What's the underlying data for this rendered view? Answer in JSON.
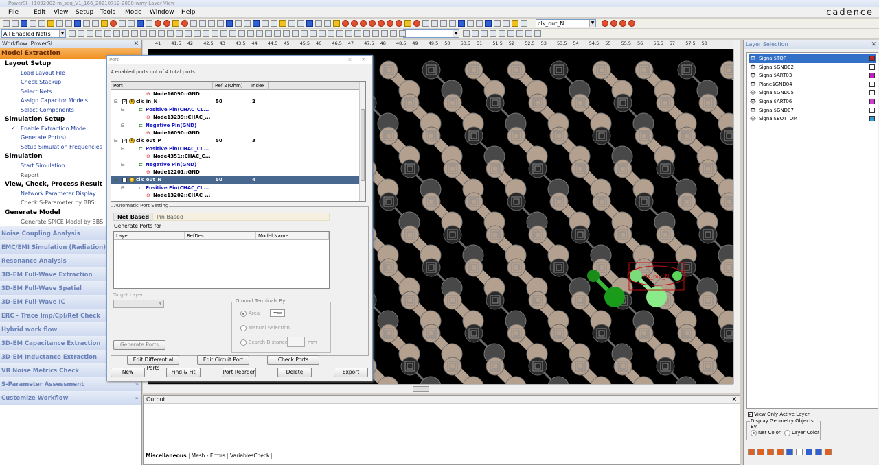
{
  "window": {
    "title": "PowerSI - [1092902-m_seq_V1_166_20210712-2000-wmy Layer View]",
    "brand": "cadence"
  },
  "menu": [
    "File",
    "Edit",
    "View",
    "Setup",
    "Tools",
    "Mode",
    "Window",
    "Help"
  ],
  "toolbar": {
    "net_filter": "All Enabled Net(s)",
    "net_search": "clk_out_N",
    "ruler_ticks": [
      "41",
      "41.5",
      "42",
      "42.5",
      "43",
      "43.5",
      "44",
      "44.5",
      "45",
      "45.5",
      "46",
      "46.5",
      "47",
      "47.5",
      "48",
      "48.5",
      "49",
      "49.5",
      "50",
      "50.5",
      "51",
      "51.5",
      "52",
      "52.5",
      "53",
      "53.5",
      "54",
      "54.5",
      "55",
      "55.5",
      "56",
      "56.5",
      "57",
      "57.5",
      "58"
    ]
  },
  "workflow": {
    "title": "Workflow: PowerSI",
    "header": "Model Extraction",
    "sections": [
      {
        "title": "Layout Setup",
        "items": [
          {
            "label": "Load Layout File",
            "gray": false,
            "checked": false
          },
          {
            "label": "Check Stackup",
            "gray": false,
            "checked": false
          },
          {
            "label": "Select Nets",
            "gray": false,
            "checked": false
          },
          {
            "label": "Assign Capacitor Models",
            "gray": false,
            "checked": false
          },
          {
            "label": "Select Components",
            "gray": false,
            "checked": false
          }
        ]
      },
      {
        "title": "Simulation Setup",
        "items": [
          {
            "label": "Enable Extraction Mode",
            "gray": false,
            "checked": true
          },
          {
            "label": "Generate Port(s)",
            "gray": false,
            "checked": false
          },
          {
            "label": "Setup Simulation Frequencies",
            "gray": false,
            "checked": false
          }
        ]
      },
      {
        "title": "Simulation",
        "items": [
          {
            "label": "Start Simulation",
            "gray": false,
            "checked": false
          },
          {
            "label": "Report",
            "gray": true,
            "checked": false
          }
        ]
      },
      {
        "title": "View, Check, Process Result",
        "items": [
          {
            "label": "Network Parameter Display",
            "gray": false,
            "checked": false
          },
          {
            "label": "Check S-Parameter by BBS",
            "gray": true,
            "checked": false
          }
        ]
      },
      {
        "title": "Generate Model",
        "items": [
          {
            "label": "Generate SPICE Model by BBS",
            "gray": true,
            "checked": false
          }
        ]
      }
    ],
    "categories": [
      "Noise Coupling Analysis",
      "EMC/EMI Simulation (Radiation)",
      "Resonance Analysis",
      "3D-EM Full-Wave Extraction",
      "3D-EM Full-Wave Spatial",
      "3D-EM Full-Wave IC",
      "ERC - Trace Imp/Cpl/Ref Check",
      "Hybrid work flow",
      "3D-EM Capacitance Extraction",
      "3D-EM Inductance Extraction",
      "VR Noise Metrics Check",
      "S-Parameter Assessment",
      "Customize Workflow"
    ]
  },
  "port_dialog": {
    "title": "Port",
    "summary": "4 enabled ports out of 4 total ports",
    "columns": [
      "Port",
      "Ref Z(Ohm)",
      "Index"
    ],
    "rows": [
      {
        "kind": "node",
        "indent": 3,
        "text": "Node16090::GND",
        "z": "",
        "idx": ""
      },
      {
        "kind": "port",
        "indent": 0,
        "text": "clk_in_N",
        "z": "50",
        "idx": "2"
      },
      {
        "kind": "pos",
        "indent": 2,
        "text": "Positive Pin(CHAC_CL...",
        "z": "",
        "idx": ""
      },
      {
        "kind": "node",
        "indent": 3,
        "text": "Node13239::CHAC_...",
        "z": "",
        "idx": ""
      },
      {
        "kind": "neg",
        "indent": 2,
        "text": "Negative Pin(GND)",
        "z": "",
        "idx": ""
      },
      {
        "kind": "node",
        "indent": 3,
        "text": "Node16090::GND",
        "z": "",
        "idx": ""
      },
      {
        "kind": "port",
        "indent": 0,
        "text": "clk_out_P",
        "z": "50",
        "idx": "3"
      },
      {
        "kind": "pos",
        "indent": 2,
        "text": "Positive Pin(CHAC_CL...",
        "z": "",
        "idx": ""
      },
      {
        "kind": "node",
        "indent": 3,
        "text": "Node4351::CHAC_C...",
        "z": "",
        "idx": ""
      },
      {
        "kind": "neg",
        "indent": 2,
        "text": "Negative Pin(GND)",
        "z": "",
        "idx": ""
      },
      {
        "kind": "node",
        "indent": 3,
        "text": "Node12201::GND",
        "z": "",
        "idx": ""
      },
      {
        "kind": "port",
        "indent": 0,
        "text": "clk_out_N",
        "z": "50",
        "idx": "4",
        "selected": true
      },
      {
        "kind": "pos",
        "indent": 2,
        "text": "Positive Pin(CHAC_CL...",
        "z": "",
        "idx": ""
      },
      {
        "kind": "node",
        "indent": 3,
        "text": "Node13202::CHAC_...",
        "z": "",
        "idx": ""
      }
    ],
    "auto": {
      "legend": "Automatic Port Setting",
      "tab_net": "Net Based",
      "tab_pin": "Pin Based",
      "generate_for": "Generate Ports for",
      "cols": [
        "Layer",
        "RefDes",
        "Model Name"
      ],
      "target_layer": "Target Layer:",
      "generate_btn": "Generate Ports",
      "ground_legend": "Ground Terminals By:",
      "area": "Area",
      "manual": "Manual Selection",
      "search": "Search Distance",
      "mm": "mm"
    },
    "buttons_row1": [
      "Edit Differential Ports",
      "Edit Circuit Port",
      "Check Ports"
    ],
    "buttons_row2": [
      "New",
      "Find & Fit",
      "Port Reorder",
      "Delete",
      "Export"
    ]
  },
  "canvas": {
    "label": "clk_out_N"
  },
  "output": {
    "title": "Output",
    "tabs": [
      "Miscellaneous",
      "Mesh - Errors",
      "VariablesCheck"
    ]
  },
  "layers": {
    "title": "Layer Selection",
    "items": [
      {
        "name": "Signal$TOP",
        "color": "#c02020",
        "selected": true
      },
      {
        "name": "Signal$GND02",
        "color": "#ffffff",
        "selected": false
      },
      {
        "name": "Signal$ART03",
        "color": "#c020c0",
        "selected": false
      },
      {
        "name": "Plane$GND04",
        "color": "#ffffff",
        "selected": false
      },
      {
        "name": "Signal$GND05",
        "color": "#ffffff",
        "selected": false
      },
      {
        "name": "Signal$ART06",
        "color": "#d040d0",
        "selected": false
      },
      {
        "name": "Signal$GND07",
        "color": "#ffffff",
        "selected": false
      },
      {
        "name": "Signal$BOTTOM",
        "color": "#30a0d0",
        "selected": false
      }
    ],
    "view_only": "View Only Active Layer",
    "display_geo": "Display Geometry Objects By",
    "net_color": "Net Color",
    "layer_color": "Layer Color"
  }
}
